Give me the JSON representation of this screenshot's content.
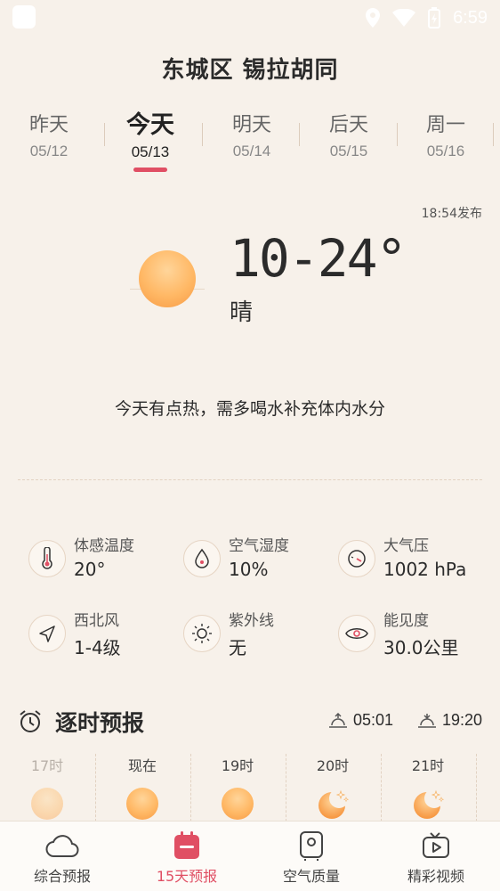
{
  "status_bar": {
    "time": "6:59"
  },
  "location": "东城区 锡拉胡同",
  "days": [
    {
      "name": "昨天",
      "date": "05/12"
    },
    {
      "name": "今天",
      "date": "05/13"
    },
    {
      "name": "明天",
      "date": "05/14"
    },
    {
      "name": "后天",
      "date": "05/15"
    },
    {
      "name": "周一",
      "date": "05/16"
    }
  ],
  "publish_time": "18:54发布",
  "today": {
    "temp_range": "10-24°",
    "condition": "晴",
    "tip": "今天有点热，需多喝水补充体内水分"
  },
  "details": [
    {
      "label": "体感温度",
      "value": "20°",
      "icon": "thermometer-icon"
    },
    {
      "label": "空气湿度",
      "value": "10%",
      "icon": "humidity-drop-icon"
    },
    {
      "label": "大气压",
      "value": "1002 hPa",
      "icon": "pressure-gauge-icon"
    },
    {
      "label": "西北风",
      "value": "1-4级",
      "icon": "wind-direction-icon"
    },
    {
      "label": "紫外线",
      "value": "无",
      "icon": "uv-sun-icon"
    },
    {
      "label": "能见度",
      "value": "30.0公里",
      "icon": "visibility-eye-icon"
    }
  ],
  "hourly": {
    "title": "逐时预报",
    "sunrise": "05:01",
    "sunset": "19:20",
    "hours": [
      {
        "label": "17时",
        "icon": "sun-icon"
      },
      {
        "label": "现在",
        "icon": "sun-icon"
      },
      {
        "label": "19时",
        "icon": "sun-icon"
      },
      {
        "label": "20时",
        "icon": "moon-stars-icon"
      },
      {
        "label": "21时",
        "icon": "moon-stars-icon"
      }
    ]
  },
  "nav": [
    {
      "label": "综合预报",
      "icon": "cloud-icon"
    },
    {
      "label": "15天预报",
      "icon": "calendar-icon"
    },
    {
      "label": "空气质量",
      "icon": "air-purifier-icon"
    },
    {
      "label": "精彩视频",
      "icon": "video-play-icon"
    }
  ],
  "colors": {
    "accent": "#e04f64",
    "background": "#f7f1ea",
    "sun": "#ffb865"
  }
}
